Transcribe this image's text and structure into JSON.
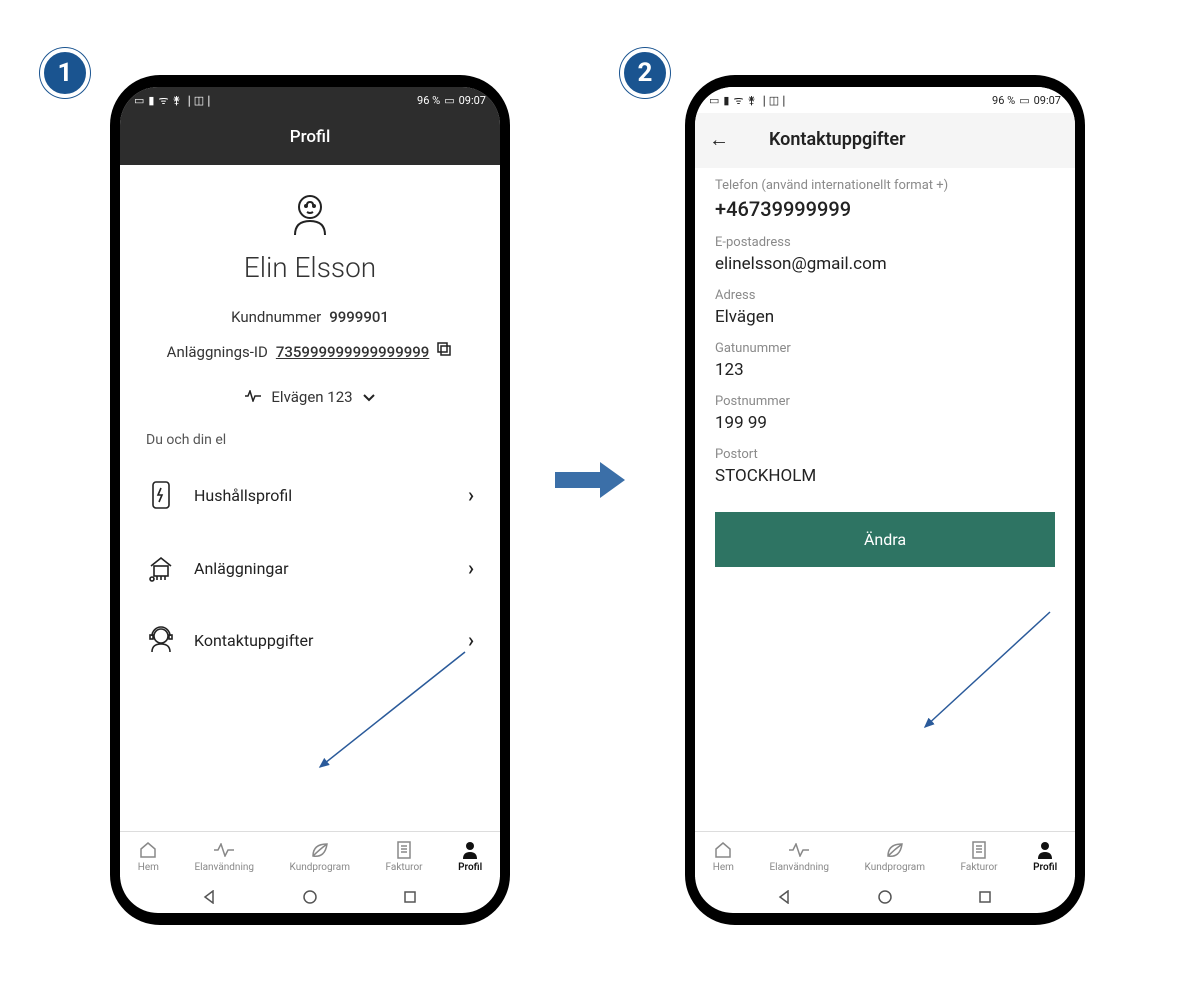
{
  "steps": {
    "one": "1",
    "two": "2"
  },
  "statusbar": {
    "battery_text": "96 %",
    "time": "09:07"
  },
  "screen1": {
    "header_title": "Profil",
    "name": "Elin Elsson",
    "customer_label": "Kundnummer",
    "customer_value": "9999901",
    "facility_label": "Anläggnings-ID",
    "facility_value": "735999999999999999",
    "address_select": "Elvägen 123",
    "section_label": "Du och din el",
    "menu": {
      "household": "Hushållsprofil",
      "facilities": "Anläggningar",
      "contact": "Kontaktuppgifter"
    }
  },
  "screen2": {
    "header_title": "Kontaktuppgifter",
    "fields": {
      "phone_label": "Telefon (använd internationellt format +)",
      "phone_value": "+46739999999",
      "email_label": "E-postadress",
      "email_value": "elinelsson@gmail.com",
      "address_label": "Adress",
      "address_value": "Elvägen",
      "streetno_label": "Gatunummer",
      "streetno_value": "123",
      "postal_label": "Postnummer",
      "postal_value": "199 99",
      "city_label": "Postort",
      "city_value": "STOCKHOLM"
    },
    "button": "Ändra"
  },
  "nav": {
    "home": "Hem",
    "usage": "Elanvändning",
    "program": "Kundprogram",
    "invoices": "Fakturor",
    "profile": "Profil"
  }
}
